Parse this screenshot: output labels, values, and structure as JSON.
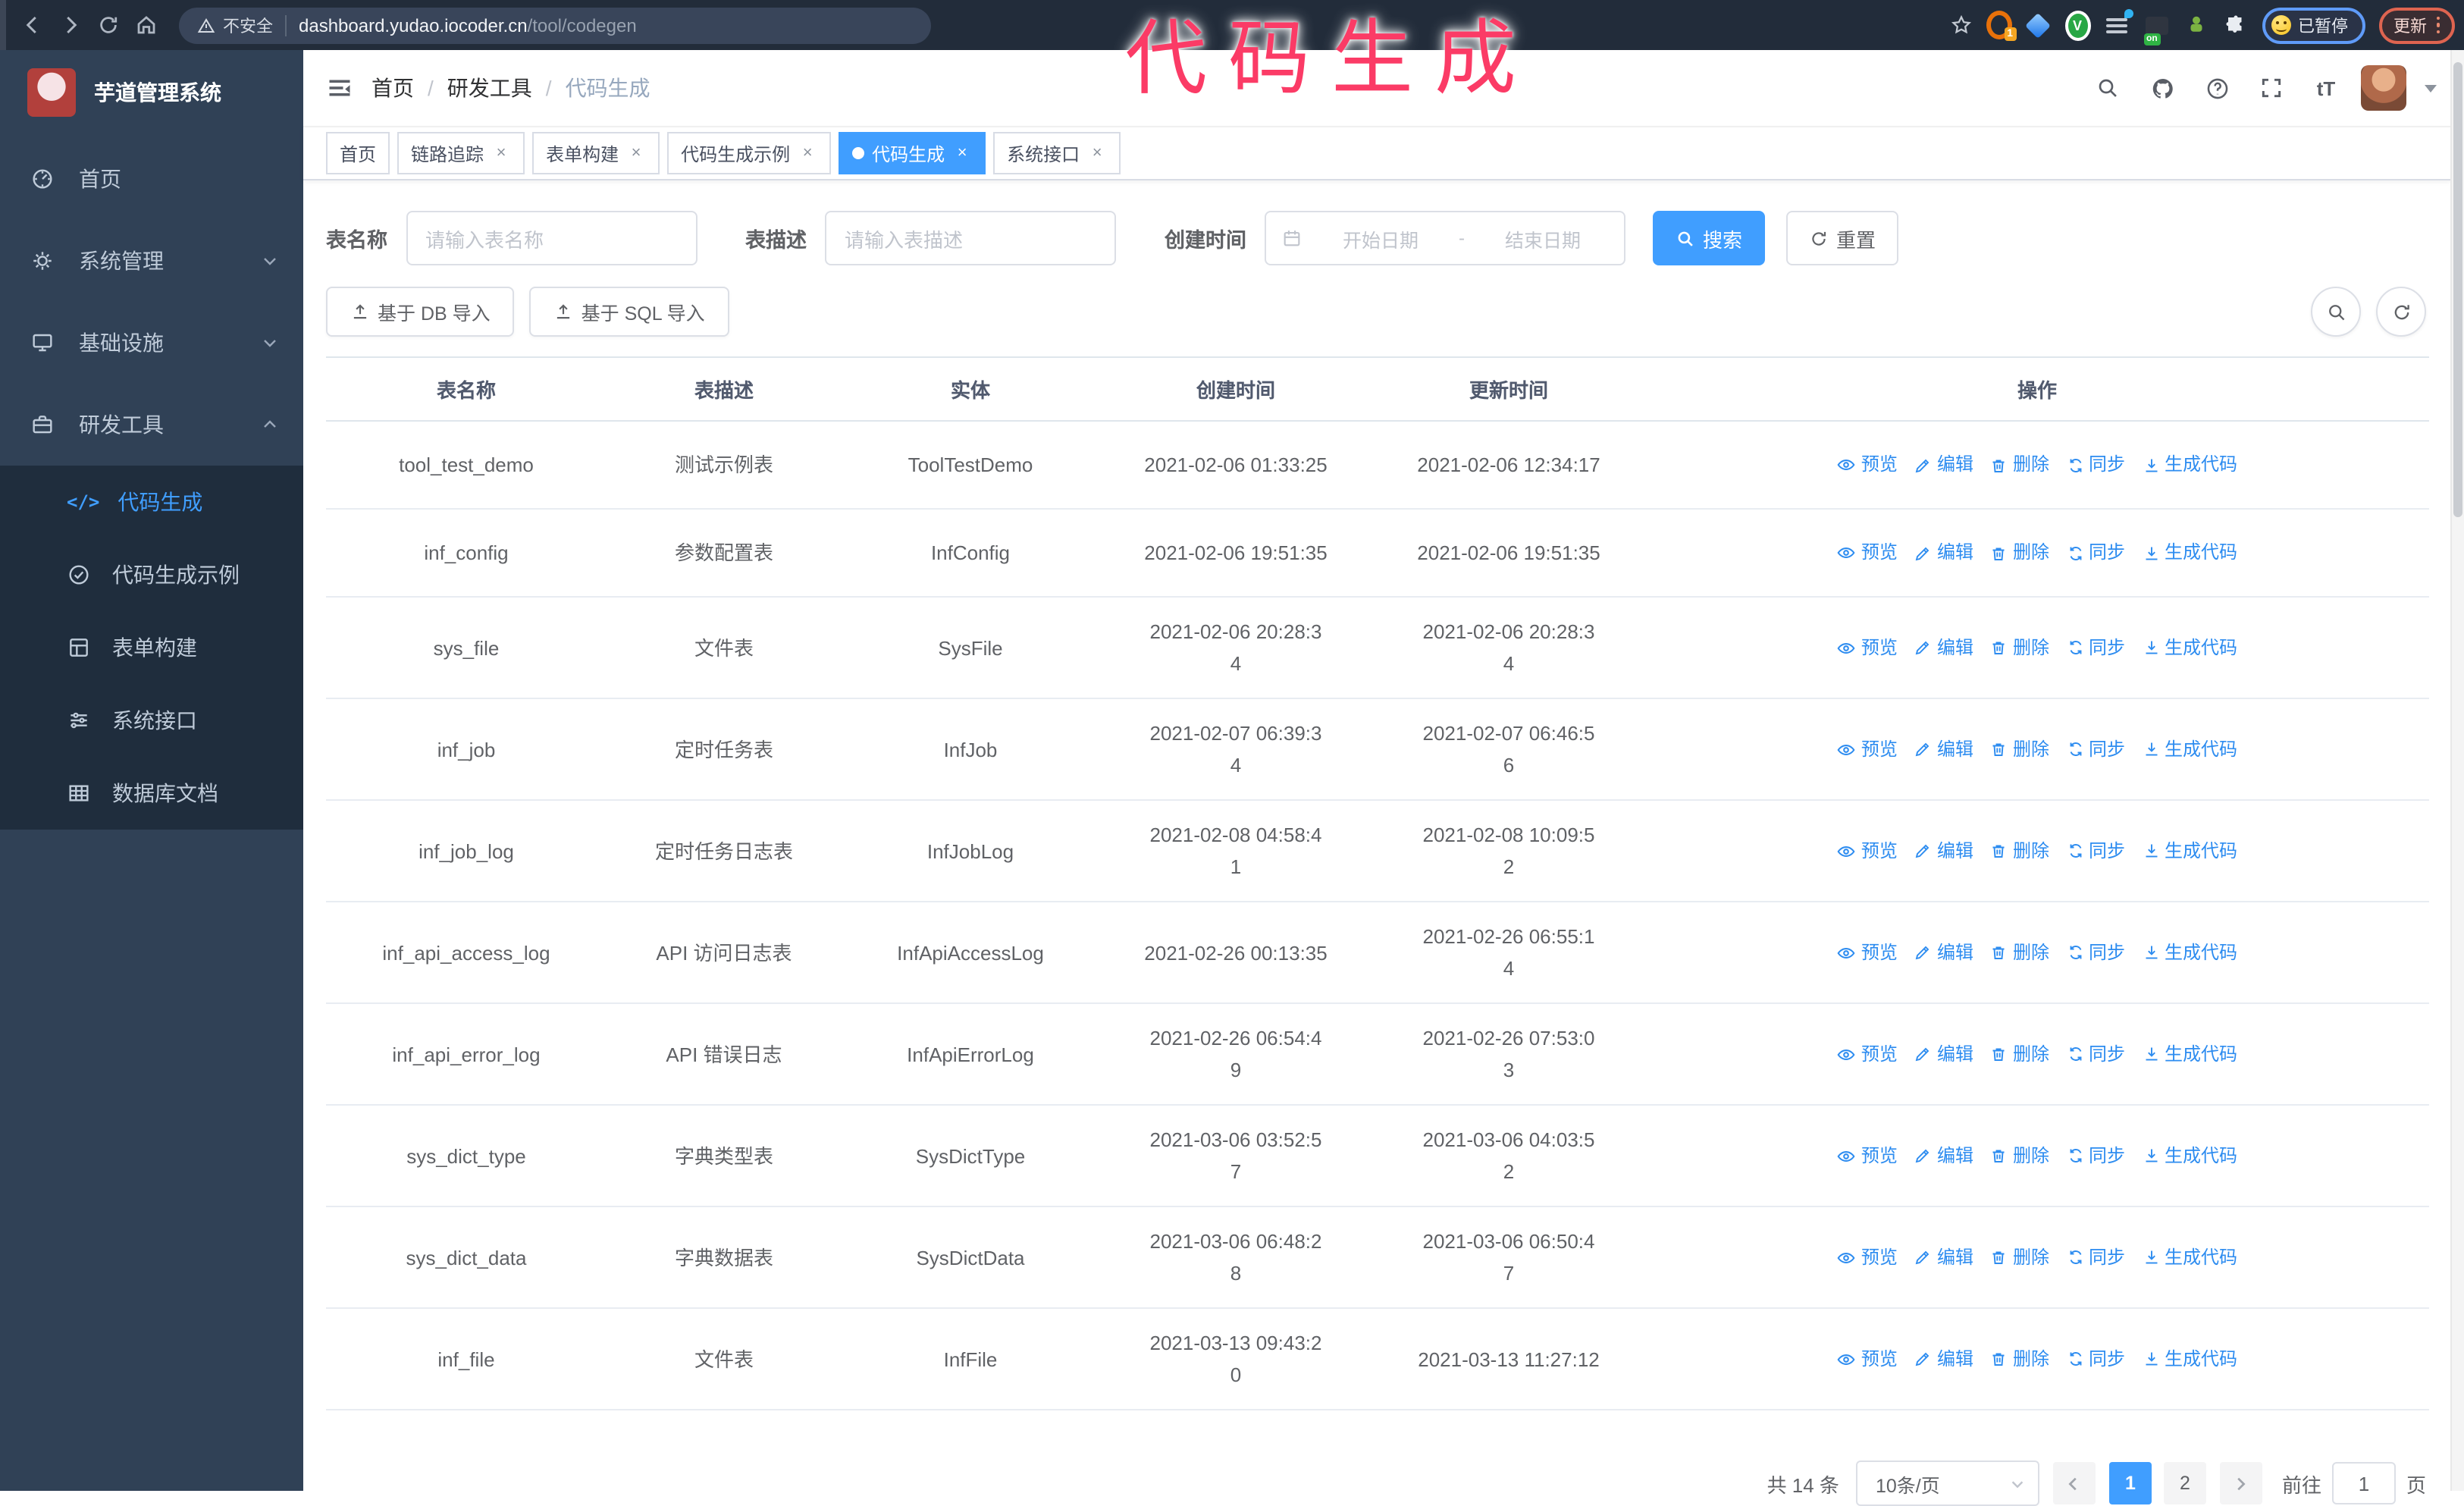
{
  "browser": {
    "security_label": "不安全",
    "url_host": "dashboard.yudao.iocoder.cn",
    "url_path": "/tool/codegen",
    "extension_badge": "1",
    "extension_on_badge": "on",
    "extension_check_glyph": "V",
    "paused_badge": "已暂停",
    "update_button": "更新"
  },
  "annotation": {
    "text": "代码生成",
    "color": "#fb3b66"
  },
  "sidebar": {
    "title": "芋道管理系统",
    "items": [
      {
        "label": "首页",
        "icon": "dashboard-icon",
        "expand": "",
        "active": false
      },
      {
        "label": "系统管理",
        "icon": "gear-icon",
        "expand": "down",
        "active": false
      },
      {
        "label": "基础设施",
        "icon": "monitor-icon",
        "expand": "down",
        "active": false
      },
      {
        "label": "研发工具",
        "icon": "toolbox-icon",
        "expand": "up",
        "active": false
      }
    ],
    "submenu": [
      {
        "label": "代码生成",
        "icon": "code-icon",
        "active": true
      },
      {
        "label": "代码生成示例",
        "icon": "check-circle-icon",
        "active": false
      },
      {
        "label": "表单构建",
        "icon": "form-icon",
        "active": false
      },
      {
        "label": "系统接口",
        "icon": "sliders-icon",
        "active": false
      },
      {
        "label": "数据库文档",
        "icon": "table-grid-icon",
        "active": false
      }
    ]
  },
  "navbar": {
    "breadcrumb": [
      "首页",
      "研发工具",
      "代码生成"
    ],
    "font_size_icon": "tT"
  },
  "tags": [
    {
      "label": "首页",
      "closable": false,
      "active": false
    },
    {
      "label": "链路追踪",
      "closable": true,
      "active": false
    },
    {
      "label": "表单构建",
      "closable": true,
      "active": false
    },
    {
      "label": "代码生成示例",
      "closable": true,
      "active": false
    },
    {
      "label": "代码生成",
      "closable": true,
      "active": true
    },
    {
      "label": "系统接口",
      "closable": true,
      "active": false
    }
  ],
  "filters": {
    "name_label": "表名称",
    "name_placeholder": "请输入表名称",
    "desc_label": "表描述",
    "desc_placeholder": "请输入表描述",
    "time_label": "创建时间",
    "start_placeholder": "开始日期",
    "range_separator": "-",
    "end_placeholder": "结束日期",
    "search_label": "搜索",
    "reset_label": "重置"
  },
  "toolbar": {
    "import_db_label": "基于 DB 导入",
    "import_sql_label": "基于 SQL 导入"
  },
  "table": {
    "columns": [
      "表名称",
      "表描述",
      "实体",
      "创建时间",
      "更新时间",
      "操作"
    ],
    "action_labels": [
      "预览",
      "编辑",
      "删除",
      "同步",
      "生成代码"
    ],
    "rows": [
      {
        "name": "tool_test_demo",
        "desc": "测试示例表",
        "entity": "ToolTestDemo",
        "created": "2021-02-06 01:33:25",
        "updated": "2021-02-06 12:34:17"
      },
      {
        "name": "inf_config",
        "desc": "参数配置表",
        "entity": "InfConfig",
        "created": "2021-02-06 19:51:35",
        "updated": "2021-02-06 19:51:35"
      },
      {
        "name": "sys_file",
        "desc": "文件表",
        "entity": "SysFile",
        "created": "2021-02-06 20:28:3\n4",
        "updated": "2021-02-06 20:28:3\n4"
      },
      {
        "name": "inf_job",
        "desc": "定时任务表",
        "entity": "InfJob",
        "created": "2021-02-07 06:39:3\n4",
        "updated": "2021-02-07 06:46:5\n6"
      },
      {
        "name": "inf_job_log",
        "desc": "定时任务日志表",
        "entity": "InfJobLog",
        "created": "2021-02-08 04:58:4\n1",
        "updated": "2021-02-08 10:09:5\n2"
      },
      {
        "name": "inf_api_access_log",
        "desc": "API 访问日志表",
        "entity": "InfApiAccessLog",
        "created": "2021-02-26 00:13:35",
        "updated": "2021-02-26 06:55:1\n4"
      },
      {
        "name": "inf_api_error_log",
        "desc": "API 错误日志",
        "entity": "InfApiErrorLog",
        "created": "2021-02-26 06:54:4\n9",
        "updated": "2021-02-26 07:53:0\n3"
      },
      {
        "name": "sys_dict_type",
        "desc": "字典类型表",
        "entity": "SysDictType",
        "created": "2021-03-06 03:52:5\n7",
        "updated": "2021-03-06 04:03:5\n2"
      },
      {
        "name": "sys_dict_data",
        "desc": "字典数据表",
        "entity": "SysDictData",
        "created": "2021-03-06 06:48:2\n8",
        "updated": "2021-03-06 06:50:4\n7"
      },
      {
        "name": "inf_file",
        "desc": "文件表",
        "entity": "InfFile",
        "created": "2021-03-13 09:43:2\n0",
        "updated": "2021-03-13 11:27:12"
      }
    ]
  },
  "pagination": {
    "total": "共 14 条",
    "page_size": "10条/页",
    "pages": [
      "1",
      "2"
    ],
    "active_page": "1",
    "goto_label": "前往",
    "goto_value": "1",
    "goto_suffix": "页"
  }
}
